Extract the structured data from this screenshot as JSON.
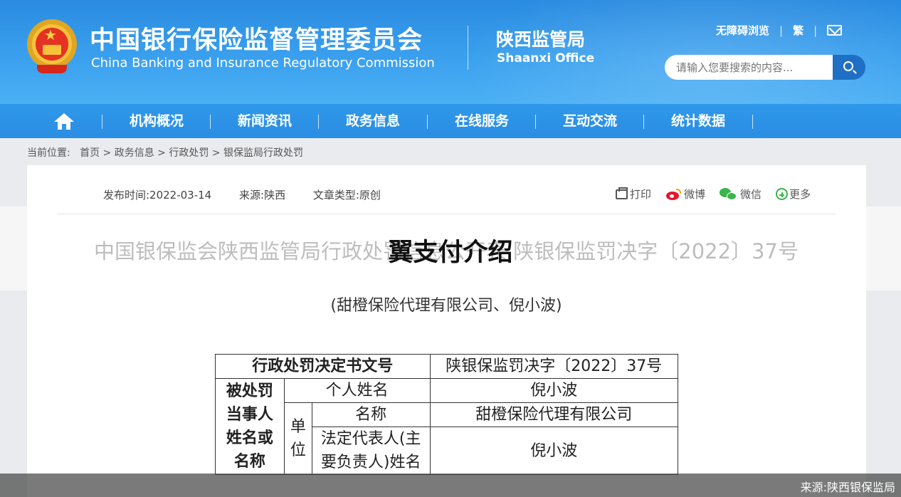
{
  "header": {
    "cn_title": "中国银行保险监督管理委员会",
    "en_title": "China Banking and Insurance Regulatory Commission",
    "office_cn": "陕西监管局",
    "office_en": "Shaanxi Office",
    "accessibility_link": "无障碍浏览",
    "traditional_link": "繁",
    "search_placeholder": "请输入您要搜索的内容...",
    "colors": {
      "header_blue": "#2a8be0",
      "nav_blue": "#2f98ea",
      "search_button": "#1f6fc4"
    }
  },
  "nav": {
    "items": [
      "机构概况",
      "新闻资讯",
      "政务信息",
      "在线服务",
      "互动交流",
      "统计数据"
    ]
  },
  "breadcrumb": {
    "label": "当前位置:",
    "items": [
      "首页",
      "政务信息",
      "行政处罚",
      "银保监局行政处罚"
    ]
  },
  "article": {
    "publish_time": "发布时间:2022-03-14",
    "source": "来源:陕西",
    "type": "文章类型:原创",
    "share": {
      "print": "打印",
      "weibo": "微博",
      "wechat": "微信",
      "more": "更多"
    },
    "title": "中国银保监会陕西监管局行政处罚信息公开表 陕银保监罚决字〔2022〕37号",
    "overlay_title": "翼支付介绍",
    "subtitle": "(甜橙保险代理有限公司、倪小波)"
  },
  "table": {
    "doc_no_label": "行政处罚决定书文号",
    "doc_no_value": "陕银保监罚决字〔2022〕37号",
    "party_label": "被处罚当事人姓名或名称",
    "personal_name_label": "个人姓名",
    "personal_name_value": "倪小波",
    "unit_label": "单位",
    "company_name_label": "名称",
    "company_name_value": "甜橙保险代理有限公司",
    "legal_rep_label": "法定代表人(主要负责人)姓名",
    "legal_rep_value": "倪小波"
  },
  "caption": "来源:陕西银保监局"
}
